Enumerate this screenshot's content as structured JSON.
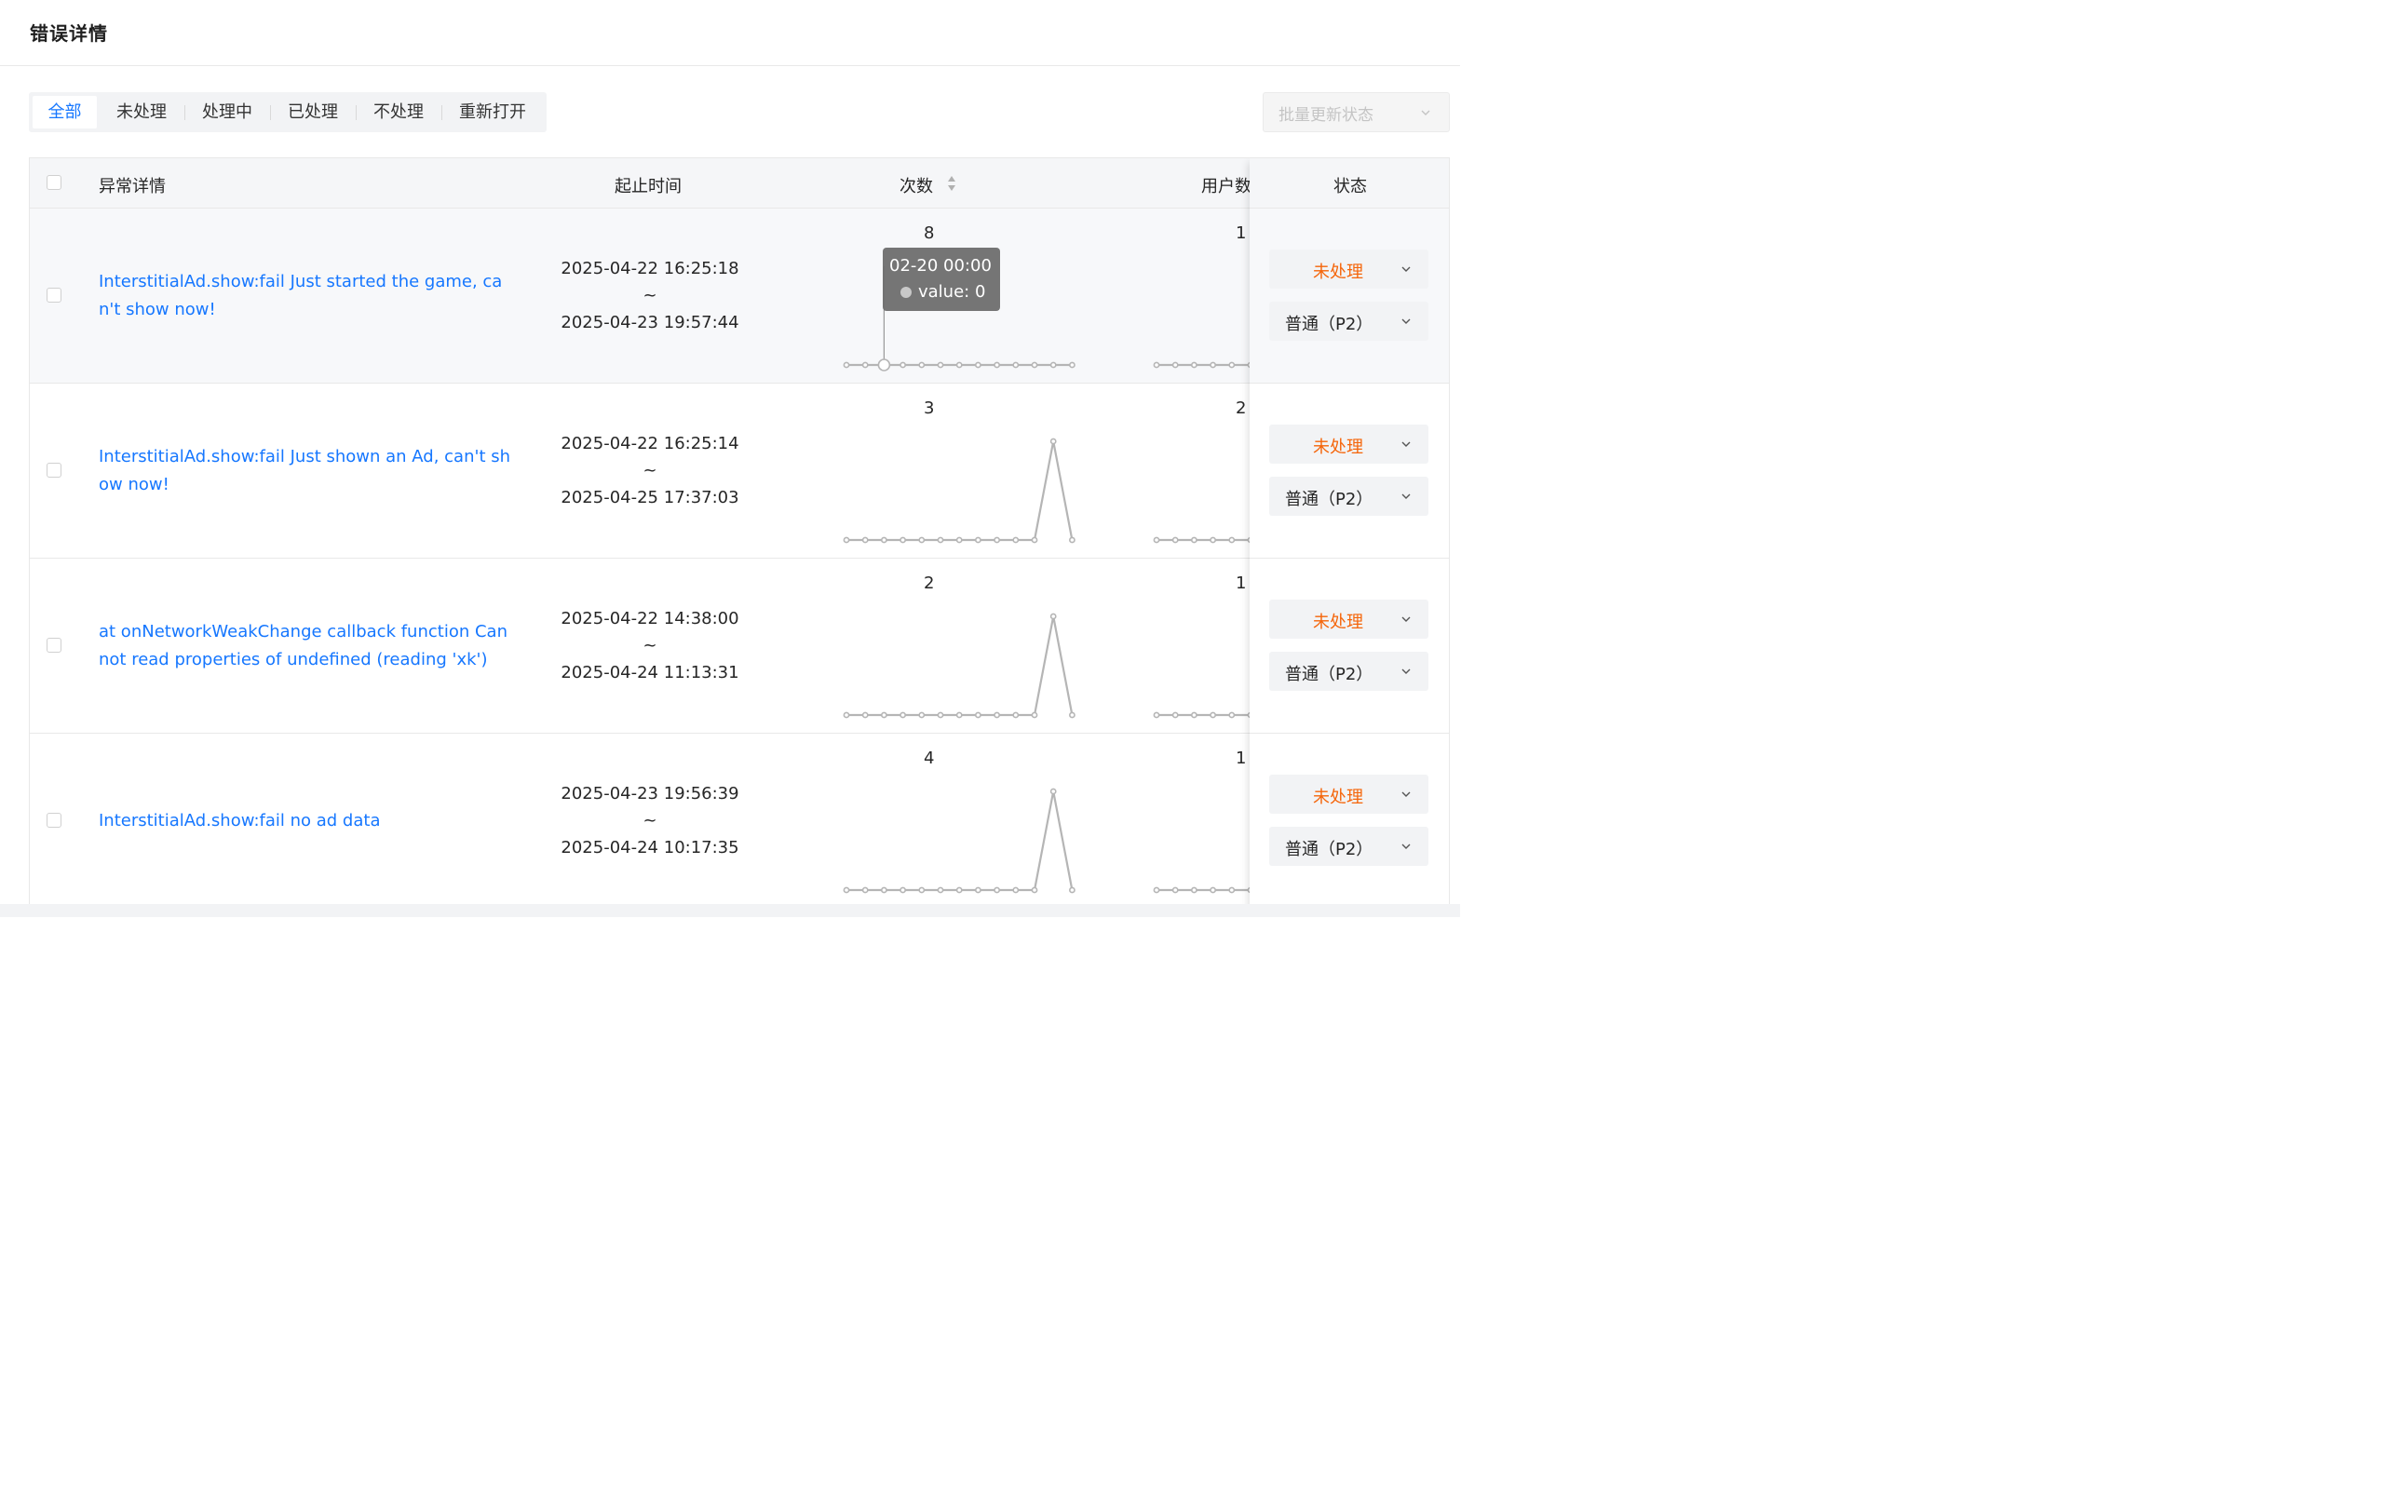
{
  "header": {
    "title": "错误详情"
  },
  "tabs": [
    {
      "label": "全部",
      "active": true
    },
    {
      "label": "未处理",
      "active": false
    },
    {
      "label": "处理中",
      "active": false
    },
    {
      "label": "已处理",
      "active": false
    },
    {
      "label": "不处理",
      "active": false
    },
    {
      "label": "重新打开",
      "active": false
    }
  ],
  "bulk_update": {
    "placeholder": "批量更新状态",
    "icon": "chevron-down-icon"
  },
  "table": {
    "columns": {
      "detail": "异常详情",
      "time_range": "起止时间",
      "count": "次数",
      "users": "用户数",
      "status": "状态"
    },
    "sort_icon": "sort-caret-icon",
    "rows": [
      {
        "message": "InterstitialAd.show:fail Just started the game, can't show now!",
        "start": "2025-04-22 16:25:18",
        "separator": "~",
        "end": "2025-04-23 19:57:44",
        "count": "8",
        "users": "1",
        "count_trend": [
          0,
          0,
          0,
          0,
          0,
          0,
          0,
          0,
          0,
          0,
          0,
          0,
          0
        ],
        "status": "未处理",
        "priority": "普通（P2）"
      },
      {
        "message": "InterstitialAd.show:fail Just shown an Ad, can't show now!",
        "start": "2025-04-22 16:25:14",
        "separator": "~",
        "end": "2025-04-25 17:37:03",
        "count": "3",
        "users": "2",
        "count_trend": [
          0,
          0,
          0,
          0,
          0,
          0,
          0,
          0,
          0,
          0,
          0,
          3,
          0
        ],
        "status": "未处理",
        "priority": "普通（P2）"
      },
      {
        "message": "at onNetworkWeakChange callback function Cannot read properties of undefined (reading 'xk')",
        "start": "2025-04-22 14:38:00",
        "separator": "~",
        "end": "2025-04-24 11:13:31",
        "count": "2",
        "users": "1",
        "count_trend": [
          0,
          0,
          0,
          0,
          0,
          0,
          0,
          0,
          0,
          0,
          0,
          2,
          0
        ],
        "status": "未处理",
        "priority": "普通（P2）"
      },
      {
        "message": "InterstitialAd.show:fail no ad data",
        "start": "2025-04-23 19:56:39",
        "separator": "~",
        "end": "2025-04-24 10:17:35",
        "count": "4",
        "users": "1",
        "count_trend": [
          0,
          0,
          0,
          0,
          0,
          0,
          0,
          0,
          0,
          0,
          0,
          4,
          0
        ],
        "status": "未处理",
        "priority": "普通（P2）"
      }
    ]
  },
  "tooltip": {
    "date": "02-20 00:00",
    "value_text": "value: 0"
  },
  "colors": {
    "link": "#1677ff",
    "status_unprocessed": "#f5650a",
    "spark": "#b5b5b5"
  }
}
